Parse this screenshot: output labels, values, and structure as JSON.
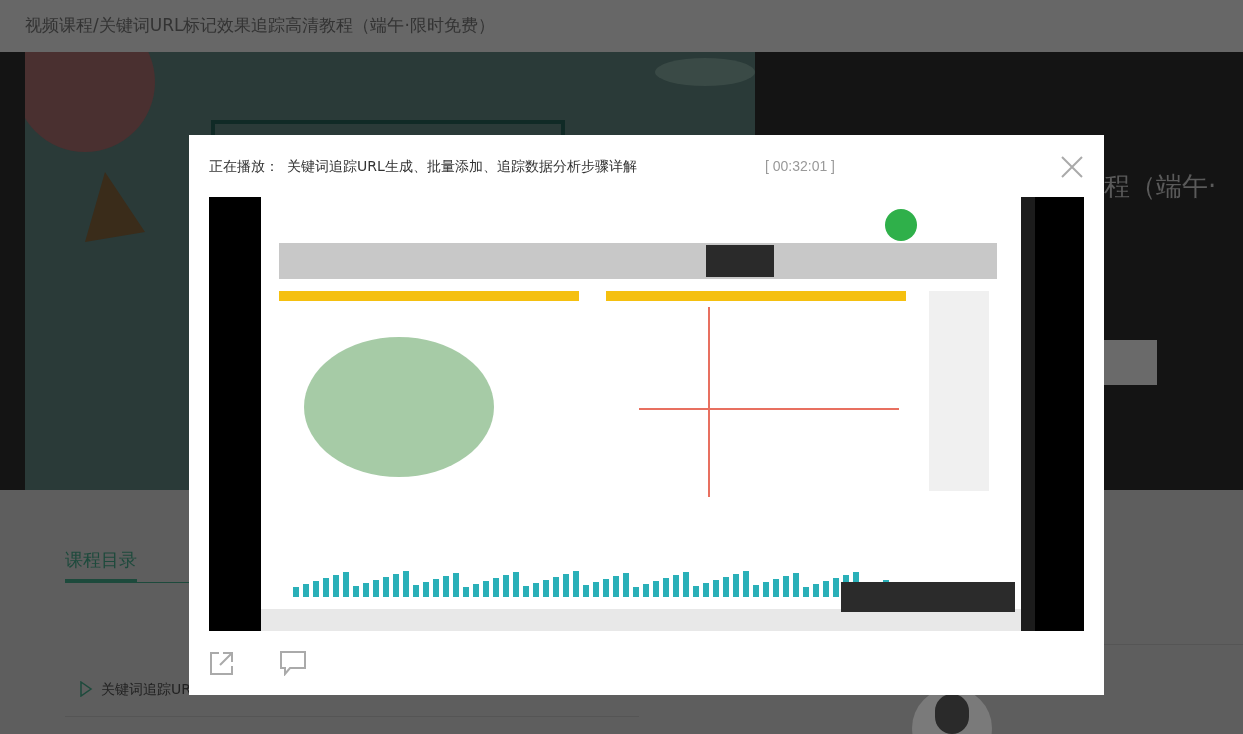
{
  "page": {
    "breadcrumb": "视频课程/关键词URL标记效果追踪高清教程（端午·限时免费）",
    "hero_title": "程（端午·",
    "catalog_tab": {
      "label": "课程目录",
      "selected": true
    },
    "lessons": [
      {
        "title": "关键词追踪UR"
      }
    ]
  },
  "modal": {
    "now_playing_label": "正在播放：",
    "video_title": "关键词追踪URL生成、批量添加、追踪数据分析步骤详解",
    "duration": "[ 00:32:01 ]"
  }
}
